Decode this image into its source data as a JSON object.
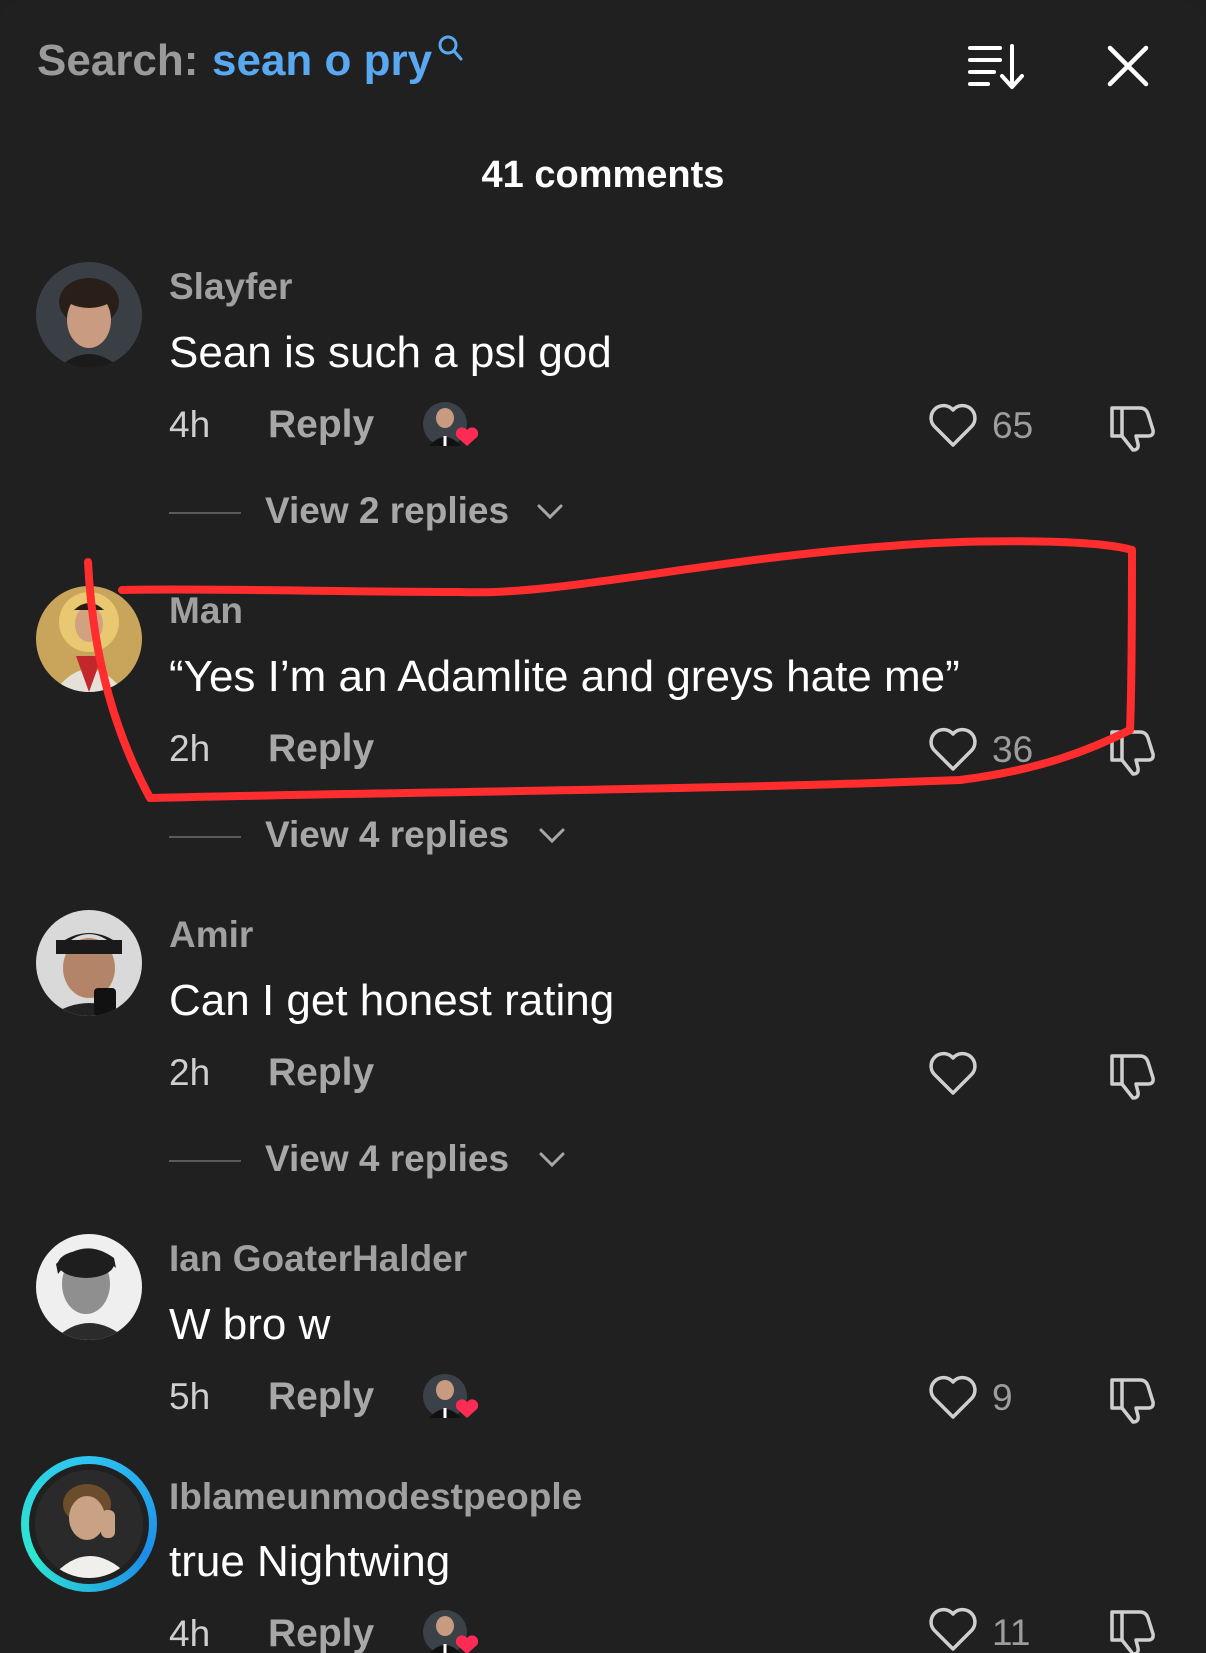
{
  "search": {
    "label": "Search:",
    "term": "sean o pry",
    "search_icon": "search-icon",
    "sort_icon": "sort-descending-icon",
    "close_icon": "close-icon"
  },
  "comments_count": "41 comments",
  "colors": {
    "background": "#202020",
    "search_term": "#59a9f2",
    "annotation_red": "#ff2d2d",
    "heart_badge": "#fe2c55",
    "story_ring": "#2ec4f0"
  },
  "comments": [
    {
      "username": "Slayfer",
      "text": "Sean is such a psl god",
      "time": "4h",
      "reply": "Reply",
      "creator_liked": true,
      "likes": "65",
      "view_replies": "View 2 replies"
    },
    {
      "username": "Man",
      "text": "“Yes I’m an Adamlite and greys hate me”",
      "time": "2h",
      "reply": "Reply",
      "creator_liked": false,
      "likes": "36",
      "view_replies": "View 4 replies",
      "circled": true
    },
    {
      "username": "Amir",
      "text": "Can I get honest rating",
      "time": "2h",
      "reply": "Reply",
      "creator_liked": false,
      "likes": "",
      "view_replies": "View 4 replies"
    },
    {
      "username": "Ian GoaterHalder",
      "text": "W bro w",
      "time": "5h",
      "reply": "Reply",
      "creator_liked": true,
      "likes": "9"
    },
    {
      "username": "Iblameunmodestpeople",
      "text": "true Nightwing",
      "time": "4h",
      "reply": "Reply",
      "creator_liked": true,
      "likes": "11",
      "story_ring": true
    }
  ]
}
